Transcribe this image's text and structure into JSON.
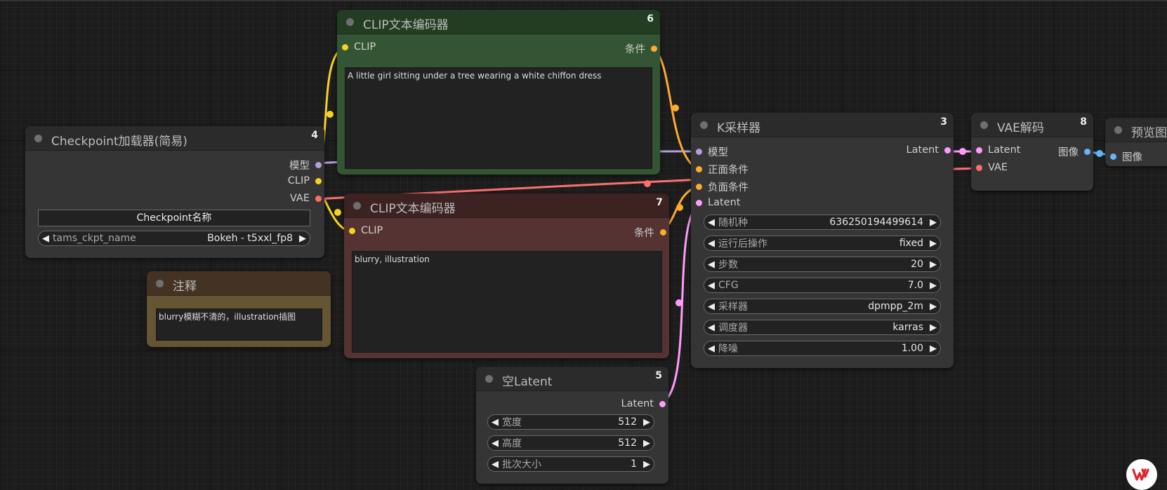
{
  "colors": {
    "clip": "#f6d122",
    "conditioning": "#ffa931",
    "model": "#b39ddb",
    "vae": "#ff6e6e",
    "latent": "#ff9cf9",
    "image": "#64b5f6"
  },
  "nodes": {
    "clip_pos": {
      "title": "CLIP文本编码器",
      "id": "6",
      "input_clip": "CLIP",
      "output_cond": "条件",
      "text": "A little girl sitting under a tree wearing a white chiffon dress"
    },
    "clip_neg": {
      "title": "CLIP文本编码器",
      "id": "7",
      "input_clip": "CLIP",
      "output_cond": "条件",
      "text": "blurry, illustration"
    },
    "checkpoint": {
      "title": "Checkpoint加载器(简易)",
      "id": "4",
      "out_model": "模型",
      "out_clip": "CLIP",
      "out_vae": "VAE",
      "ckpt_title": "Checkpoint名称",
      "widget_label": "tams_ckpt_name",
      "widget_value": "Bokeh - t5xxl_fp8"
    },
    "note": {
      "title": "注释",
      "text": "blurry模糊不清的，illustration插图"
    },
    "ksampler": {
      "title": "K采样器",
      "id": "3",
      "in_model": "模型",
      "in_pos": "正面条件",
      "in_neg": "负面条件",
      "in_latent": "Latent",
      "out_latent": "Latent",
      "widgets": [
        {
          "label": "随机种",
          "value": "636250194499614"
        },
        {
          "label": "运行后操作",
          "value": "fixed"
        },
        {
          "label": "步数",
          "value": "20"
        },
        {
          "label": "CFG",
          "value": "7.0"
        },
        {
          "label": "采样器",
          "value": "dpmpp_2m"
        },
        {
          "label": "调度器",
          "value": "karras"
        },
        {
          "label": "降噪",
          "value": "1.00"
        }
      ]
    },
    "vae_decode": {
      "title": "VAE解码",
      "id": "8",
      "in_latent": "Latent",
      "in_vae": "VAE",
      "out_image": "图像"
    },
    "preview": {
      "title": "预览图",
      "in_image": "图像"
    },
    "empty_latent": {
      "title": "空Latent",
      "id": "5",
      "out_latent": "Latent",
      "widgets": [
        {
          "label": "宽度",
          "value": "512"
        },
        {
          "label": "高度",
          "value": "512"
        },
        {
          "label": "批次大小",
          "value": "1"
        }
      ]
    }
  },
  "wps_icon": "wps-logo-icon"
}
